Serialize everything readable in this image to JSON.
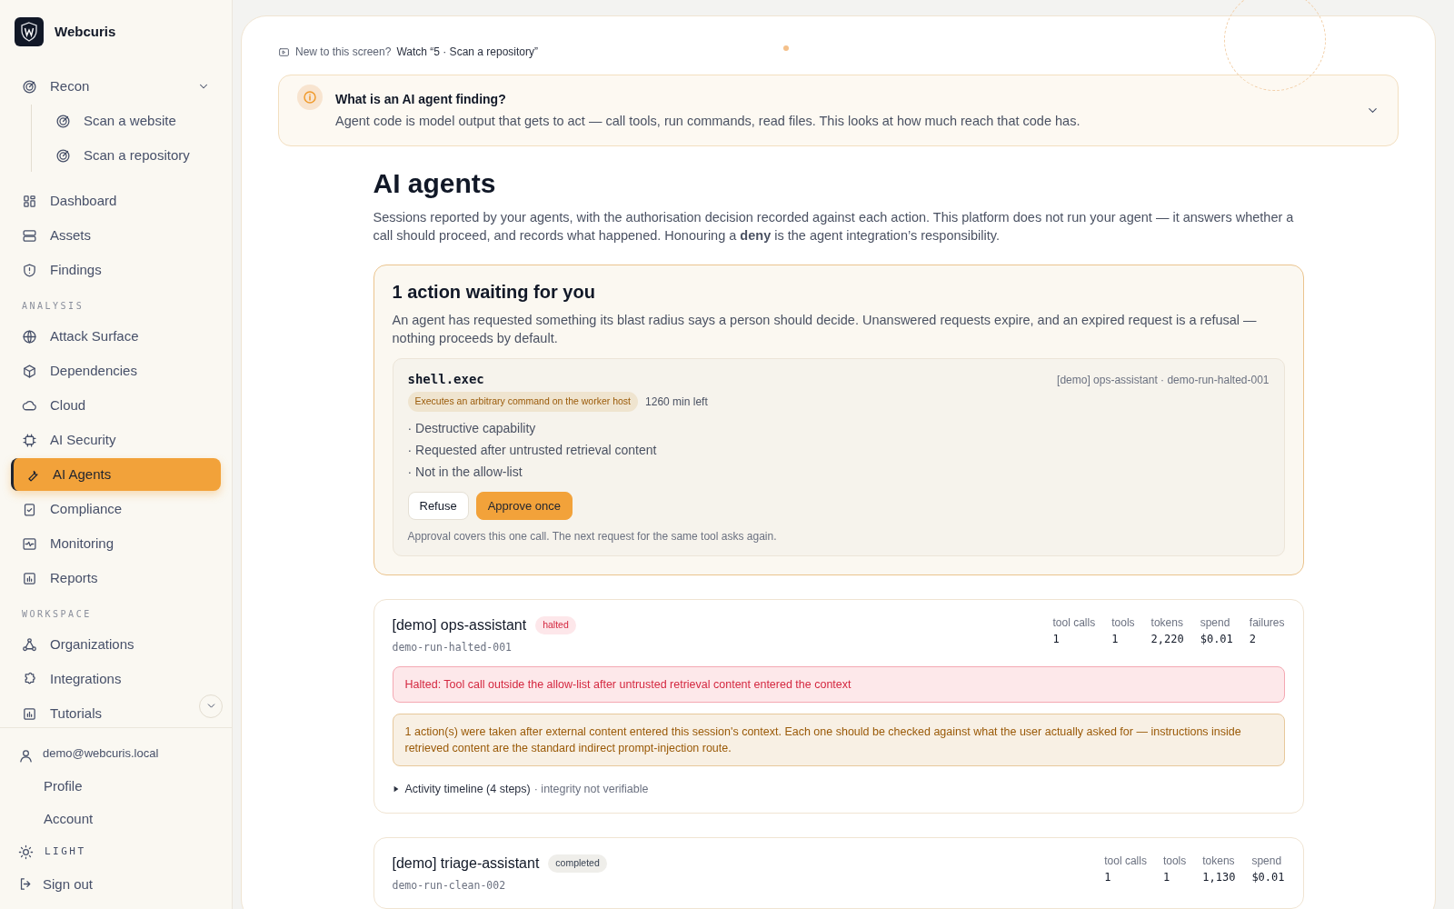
{
  "sidebar": {
    "brand": "Webcuris",
    "groups": [
      {
        "items": [
          {
            "label": "Recon",
            "selected": false,
            "expanded": true,
            "children": [
              {
                "label": "Scan a website",
                "selected": false
              },
              {
                "label": "Scan a repository",
                "selected": false
              }
            ]
          },
          {
            "label": "Dashboard",
            "selected": false
          },
          {
            "label": "Assets",
            "selected": false
          },
          {
            "label": "Findings",
            "selected": false
          }
        ]
      },
      {
        "heading": "ANALYSIS",
        "items": [
          {
            "label": "Attack Surface",
            "selected": false
          },
          {
            "label": "Dependencies",
            "selected": false
          },
          {
            "label": "Cloud",
            "selected": false
          },
          {
            "label": "AI Security",
            "selected": false
          },
          {
            "label": "AI Agents",
            "selected": true
          },
          {
            "label": "Compliance",
            "selected": false
          },
          {
            "label": "Monitoring",
            "selected": false
          },
          {
            "label": "Reports",
            "selected": false
          }
        ]
      },
      {
        "heading": "WORKSPACE",
        "items": [
          {
            "label": "Organizations",
            "selected": false
          },
          {
            "label": "Integrations",
            "selected": false
          },
          {
            "label": "Tutorials",
            "selected": false
          }
        ]
      }
    ],
    "user": {
      "email": "demo@webcuris.local",
      "links": [
        "Profile",
        "Account"
      ]
    },
    "theme": "LIGHT",
    "sign_out": "Sign out"
  },
  "tutorial_hint": {
    "prefix": "New to this screen?",
    "link": "Watch “5 · Scan a repository”"
  },
  "explainer": {
    "title": "What is an AI agent finding?",
    "text": "Agent code is model output that gets to act — call tools, run commands, read files. This looks at how much reach that code has.",
    "expanded": false
  },
  "page": {
    "title": "AI agents",
    "description": "Sessions reported by your agents, with the authorisation decision recorded against each action. This platform does not run your agent — it answers whether a call should proceed, and records what happened. Honouring a **deny** is the agent integration’s responsibility."
  },
  "pending": {
    "title": "1 action waiting for you",
    "text": "An agent has requested something its blast radius says a person should decide. Unanswered requests expire, and an expired request is a refusal — nothing proceeds by default.",
    "requests": [
      {
        "tool": "shell.exec",
        "source": "[demo] ops-assistant · demo-run-halted-001",
        "risk": "Executes an arbitrary command on the worker host",
        "time_left": "1260 min left",
        "reasons": [
          "· Destructive capability",
          "· Requested after untrusted retrieval content",
          "· Not in the allow-list"
        ],
        "buttons": [
          {
            "label": "Refuse",
            "kind": "secondary"
          },
          {
            "label": "Approve once",
            "kind": "primary"
          }
        ],
        "note": "Approval covers this one call. The next request for the same tool asks again."
      }
    ]
  },
  "sessions": [
    {
      "name": "[demo] ops-assistant",
      "status": "halted",
      "run_id": "demo-run-halted-001",
      "stats": [
        {
          "label": "tool calls",
          "value": "1"
        },
        {
          "label": "tools",
          "value": "1"
        },
        {
          "label": "tokens",
          "value": "2,220"
        },
        {
          "label": "spend",
          "value": "$0.01"
        },
        {
          "label": "failures",
          "value": "2"
        }
      ],
      "alerts": [
        {
          "kind": "error",
          "text": "Halted: Tool call outside the allow-list after untrusted retrieval content entered the context"
        },
        {
          "kind": "warning",
          "text": "1 action(s) were taken after external content entered this session's context. Each one should be checked against what the user actually asked for — instructions inside retrieved content are the standard indirect prompt-injection route."
        }
      ],
      "timeline": {
        "label": "Activity timeline (4 steps)",
        "note": "· integrity not verifiable",
        "expanded": false
      }
    },
    {
      "name": "[demo] triage-assistant",
      "status": "completed",
      "run_id": "demo-run-clean-002",
      "stats": [
        {
          "label": "tool calls",
          "value": "1"
        },
        {
          "label": "tools",
          "value": "1"
        },
        {
          "label": "tokens",
          "value": "1,130"
        },
        {
          "label": "spend",
          "value": "$0.01"
        }
      ]
    }
  ]
}
